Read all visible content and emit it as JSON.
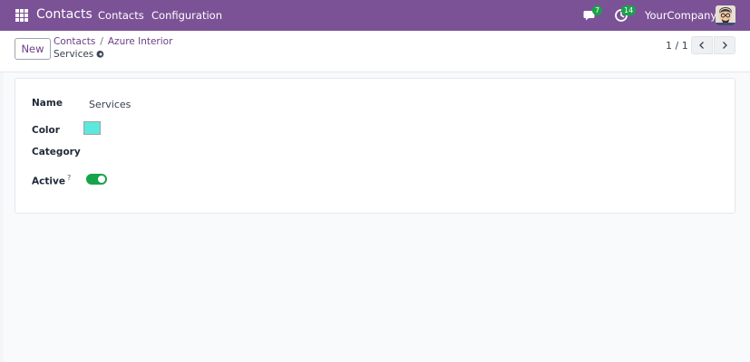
{
  "navbar": {
    "brand": "Contacts",
    "menu": [
      "Contacts",
      "Configuration"
    ],
    "chat_count": "7",
    "activity_count": "14",
    "company": "YourCompany",
    "bg_color": "#7b5296"
  },
  "control_panel": {
    "new_label": "New",
    "breadcrumb": [
      "Contacts",
      "Azure Interior"
    ],
    "breadcrumb_sep": "/",
    "record_name": "Services",
    "pager": "1 / 1"
  },
  "form": {
    "name_label": "Name",
    "name_value": "Services",
    "color_label": "Color",
    "color_value": "#5ce8dc",
    "category_label": "Category",
    "active_label": "Active",
    "active_help": "?",
    "active_value": true
  },
  "colors": {
    "accent": "#6b3f86",
    "toggle_on": "#17a34a"
  }
}
